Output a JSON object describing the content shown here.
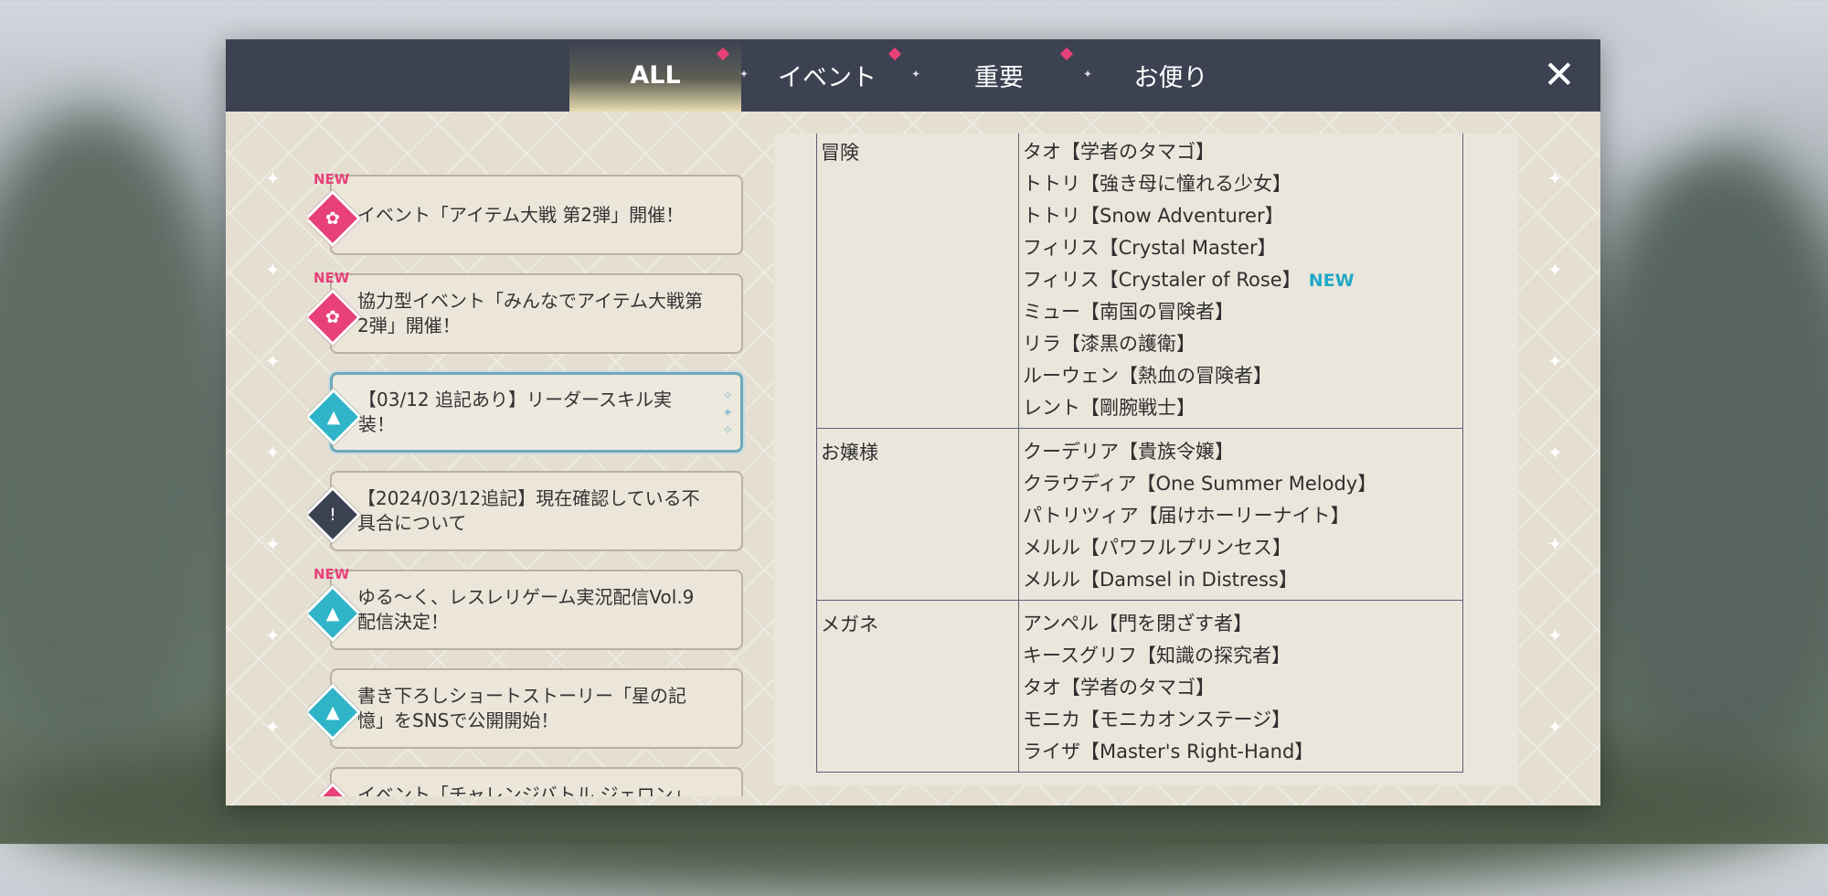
{
  "header": {
    "tabs": [
      {
        "label": "ALL"
      },
      {
        "label": "イベント"
      },
      {
        "label": "重要"
      },
      {
        "label": "お便り"
      }
    ],
    "close_label": "✕"
  },
  "news": [
    {
      "new_label": "NEW",
      "text": "イベント「アイテム大戦 第2弾」開催！",
      "icon": "event-icon",
      "color": "#e8417a"
    },
    {
      "new_label": "NEW",
      "text": "協力型イベント「みんなでアイテム大戦第2弾」開催！",
      "icon": "event-icon",
      "color": "#e8417a"
    },
    {
      "new_label": "",
      "text": "【03/12 追記あり】リーダースキル実装！",
      "icon": "bell-icon",
      "color": "#2fb4c8"
    },
    {
      "new_label": "",
      "text": "【2024/03/12追記】現在確認している不具合について",
      "icon": "alert-icon",
      "color": "#3c4252"
    },
    {
      "new_label": "NEW",
      "text": "ゆる～く、レスレリゲーム実況配信Vol.9配信決定！",
      "icon": "bell-icon",
      "color": "#2fb4c8"
    },
    {
      "new_label": "",
      "text": "書き下ろしショートストーリー「星の記憶」をSNSで公開開始！",
      "icon": "bell-icon",
      "color": "#2fb4c8"
    },
    {
      "new_label": "",
      "text": "イベント「チャレンジバトル ジェロン」開催！",
      "icon": "event-icon",
      "color": "#e8417a"
    }
  ],
  "detail": {
    "rows": [
      {
        "category": "冒険",
        "names": [
          {
            "name": "タオ【学者のタマゴ】",
            "new": ""
          },
          {
            "name": "トトリ【強き母に憧れる少女】",
            "new": ""
          },
          {
            "name": "トトリ【Snow Adventurer】",
            "new": ""
          },
          {
            "name": "フィリス【Crystal Master】",
            "new": ""
          },
          {
            "name": "フィリス【Crystaler of Rose】",
            "new": "NEW"
          },
          {
            "name": "ミュー【南国の冒険者】",
            "new": ""
          },
          {
            "name": "リラ【漆黒の護衛】",
            "new": ""
          },
          {
            "name": "ルーウェン【熱血の冒険者】",
            "new": ""
          },
          {
            "name": "レント【剛腕戦士】",
            "new": ""
          }
        ]
      },
      {
        "category": "お嬢様",
        "names": [
          {
            "name": "クーデリア【貴族令嬢】",
            "new": ""
          },
          {
            "name": "クラウディア【One Summer Melody】",
            "new": ""
          },
          {
            "name": "パトリツィア【届けホーリーナイト】",
            "new": ""
          },
          {
            "name": "メルル【パワフルプリンセス】",
            "new": ""
          },
          {
            "name": "メルル【Damsel in Distress】",
            "new": ""
          }
        ]
      },
      {
        "category": "メガネ",
        "names": [
          {
            "name": "アンペル【門を閉ざす者】",
            "new": ""
          },
          {
            "name": "キースグリフ【知識の探究者】",
            "new": ""
          },
          {
            "name": "タオ【学者のタマゴ】",
            "new": ""
          },
          {
            "name": "モニカ【モニカオンステージ】",
            "new": ""
          },
          {
            "name": "ライザ【Master's Right-Hand】",
            "new": ""
          }
        ]
      }
    ]
  },
  "colors": {
    "header_bg": "#3c4252",
    "accent_pink": "#e8417a",
    "accent_teal": "#2fb4c8",
    "new_tag": "#22a8c6"
  }
}
